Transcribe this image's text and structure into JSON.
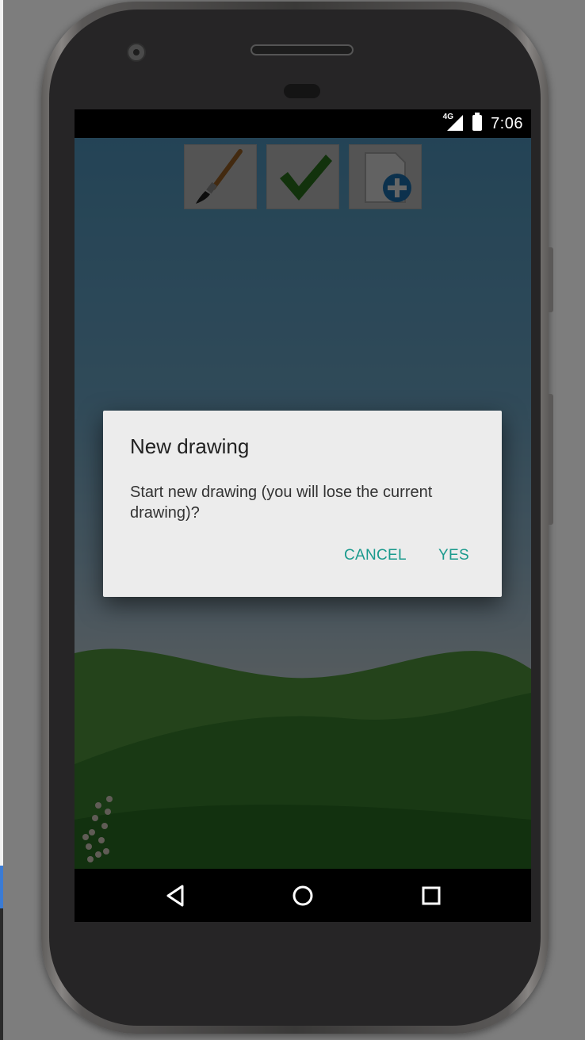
{
  "status_bar": {
    "network": "4G",
    "time": "7:06",
    "icons": [
      "signal-icon",
      "battery-charging-icon"
    ]
  },
  "toolbar": {
    "buttons": [
      {
        "name": "brush",
        "icon": "paintbrush-icon"
      },
      {
        "name": "done",
        "icon": "checkmark-icon"
      },
      {
        "name": "new",
        "icon": "new-document-icon"
      }
    ]
  },
  "dialog": {
    "title": "New drawing",
    "message": "Start new drawing (you will lose the current drawing)?",
    "cancel_label": "CANCEL",
    "yes_label": "YES",
    "accent_color": "#1a9a8d"
  },
  "nav_bar": {
    "icons": [
      "back-icon",
      "home-icon",
      "recents-icon"
    ]
  }
}
